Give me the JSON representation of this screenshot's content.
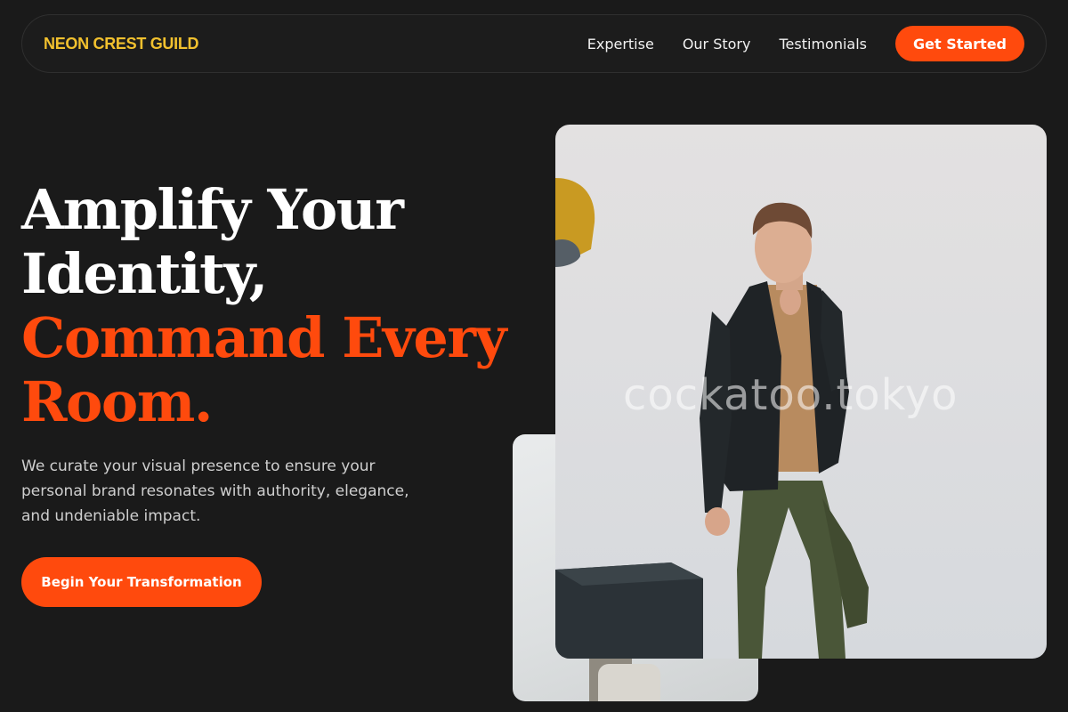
{
  "nav": {
    "brand": "NEON CREST GUILD",
    "links": [
      "Expertise",
      "Our Story",
      "Testimonials"
    ],
    "cta": "Get Started"
  },
  "hero": {
    "headline_line1": "Amplify Your",
    "headline_line2": "Identity,",
    "headline_line3": "Command Every",
    "headline_line4": "Room.",
    "lead": "We curate your visual presence to ensure your personal brand resonates with authority, elegance, and undeniable impact.",
    "cta": "Begin Your Transformation"
  },
  "images": {
    "main_watermark": "cockatoo.tokyo"
  },
  "colors": {
    "background": "#1a1a1a",
    "brand": "#f2c12e",
    "accent": "#ff4a0d"
  }
}
